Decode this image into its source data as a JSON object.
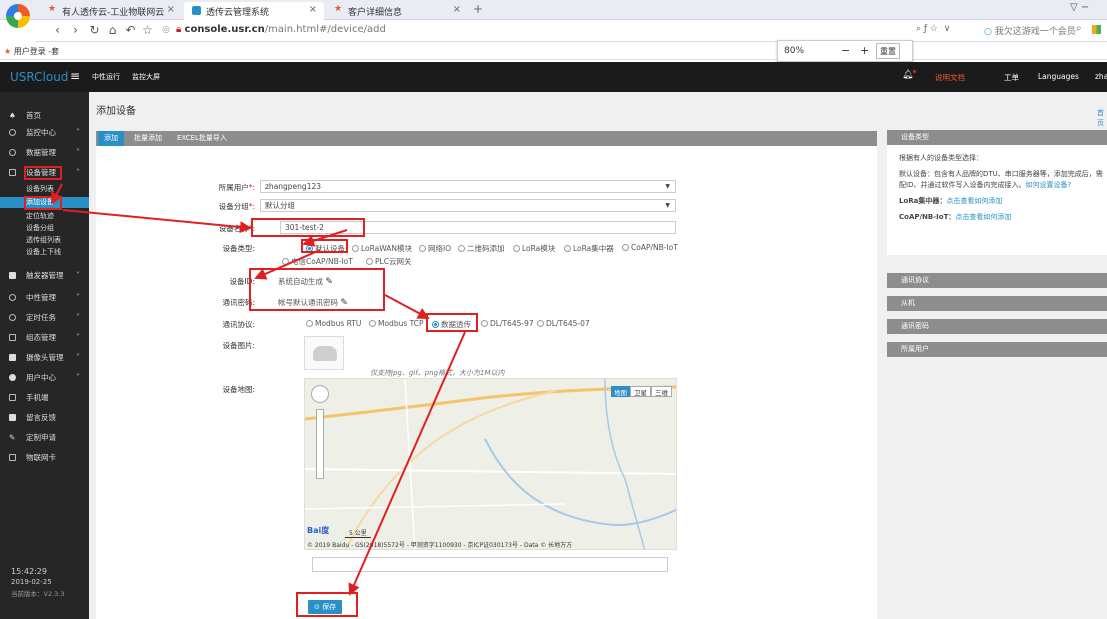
{
  "browser": {
    "tabs": [
      {
        "label": "有人透传云-工业物联网云",
        "active": false
      },
      {
        "label": "透传云管理系统",
        "active": true
      },
      {
        "label": "客户详细信息",
        "active": false
      }
    ],
    "new_tab_symbol": "+",
    "tab_close_symbol": "×",
    "url_domain": "console.usr.cn",
    "url_path": "/main.html#/device/add",
    "address_right_hint": "我欠这游戏一个会员",
    "bookmark": "用户登录 -套",
    "zoom_value": "80%",
    "zoom_minus": "−",
    "zoom_plus": "+",
    "zoom_reset": "重置"
  },
  "app": {
    "logo": "USRCloud",
    "menu_icon": "hamburger-icon",
    "top_nav": [
      "中性运行",
      "监控大屏"
    ],
    "header_right": [
      "说明文档",
      "工单",
      "Languages",
      "zha"
    ],
    "accent": "#2a8fc7"
  },
  "sidebar": {
    "items": [
      {
        "label": "首页",
        "chevron": false
      },
      {
        "label": "监控中心",
        "chevron": true
      },
      {
        "label": "数据管理",
        "chevron": true
      },
      {
        "label": "设备管理",
        "chevron": true,
        "expanded": true
      },
      {
        "label": "触发器管理",
        "chevron": true
      },
      {
        "label": "中性管理",
        "chevron": true
      },
      {
        "label": "定时任务",
        "chevron": true
      },
      {
        "label": "组态管理",
        "chevron": true
      },
      {
        "label": "摄像头管理",
        "chevron": true
      },
      {
        "label": "用户中心",
        "chevron": true
      },
      {
        "label": "手机端",
        "chevron": false
      },
      {
        "label": "留言反馈",
        "chevron": false
      },
      {
        "label": "定制申请",
        "chevron": false
      },
      {
        "label": "物联网卡",
        "chevron": false
      }
    ],
    "sub_items": [
      "设备列表",
      "添加设备",
      "定位轨迹",
      "设备分组",
      "透传组列表",
      "设备上下线"
    ],
    "time": "15:42:29",
    "date": "2019-02-25",
    "version": "当前版本：V2.3.3"
  },
  "page": {
    "title": "添加设备",
    "breadcrumb": "首页",
    "tabs": [
      "添加",
      "批量添加",
      "EXCEL批量导入"
    ]
  },
  "form": {
    "owner_label": "所属用户",
    "owner_value": "zhangpeng123",
    "group_label": "设备分组",
    "group_value": "默认分组",
    "name_label": "设备名称",
    "name_value": "301-test-2",
    "type_label": "设备类型",
    "type_options": [
      "默认设备",
      "LoRaWAN模块",
      "网络IO",
      "二维码添加",
      "LoRa模块",
      "LoRa集中器",
      "CoAP/NB-IoT"
    ],
    "type_options_row2": [
      "电信CoAP/NB-IoT",
      "PLC云网关"
    ],
    "id_label": "设备ID",
    "id_value": "系统自动生成",
    "pwd_label": "通讯密码",
    "pwd_value": "帐号默认通讯密码",
    "protocol_label": "通讯协议",
    "protocol_options": [
      "Modbus RTU",
      "Modbus TCP",
      "数据透传",
      "DL/T645-97",
      "DL/T645-07"
    ],
    "image_label": "设备图片",
    "image_hint": "仅支持jpg、gif、png格式，大小为1M以内",
    "map_label": "设备地图",
    "map_buttons": [
      "地图",
      "卫星",
      "三维"
    ],
    "map_scale": "5 公里",
    "map_copyright": "© 2019 Baidu - GS(2018)5572号 - 甲测资字1100930 - 京ICP证030173号 - Data © 长地万方",
    "save_label": "保存"
  },
  "right_panel": {
    "type_header": "设备类型",
    "intro": "根据有人的设备类型选择：",
    "default_desc": "默认设备：包含有人品牌的DTU、串口服务器等，添加完成后，需配ID、并通过软件写入设备内完成接入。",
    "default_link": "如何设置设备?",
    "lora_label": "LoRa集中器：",
    "lora_link": "点击查看如何添加",
    "coap_label": "CoAP/NB-IoT：",
    "coap_link": "点击查看如何添加",
    "sections": [
      "通讯协议",
      "从机",
      "通讯密码",
      "所属用户"
    ]
  }
}
